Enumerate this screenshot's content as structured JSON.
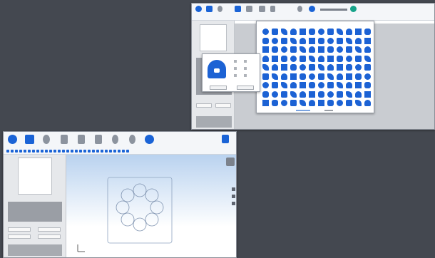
{
  "colors": {
    "desktop": "#444850",
    "accent": "#1a63d6",
    "canvas_grey": "#c9ccd1"
  },
  "top_window": {
    "toolbar": [
      {
        "icon": "circle-icon",
        "label": ""
      },
      {
        "icon": "home-icon",
        "label": ""
      },
      {
        "icon": "pen-icon",
        "label": ""
      },
      {
        "icon": "square-icon",
        "label": ""
      },
      {
        "icon": "grid-icon",
        "label": ""
      },
      {
        "icon": "print-icon",
        "label": ""
      },
      {
        "icon": "file-icon",
        "label": ""
      },
      {
        "icon": "settings-icon",
        "label": ""
      },
      {
        "icon": "user-icon",
        "label": ""
      },
      {
        "icon": "tool-icon",
        "label": ""
      }
    ],
    "lock_dialog": {
      "ok": "",
      "cancel": ""
    }
  },
  "bottom_window": {
    "toolbar": [
      {
        "icon": "circle-icon",
        "label": ""
      },
      {
        "icon": "home-icon",
        "label": ""
      },
      {
        "icon": "pen-icon",
        "label": ""
      },
      {
        "icon": "file-icon",
        "label": ""
      },
      {
        "icon": "settings-icon",
        "label": ""
      },
      {
        "icon": "layers-icon",
        "label": ""
      },
      {
        "icon": "lamp-icon",
        "label": ""
      },
      {
        "icon": "globe-icon",
        "label": ""
      }
    ]
  }
}
